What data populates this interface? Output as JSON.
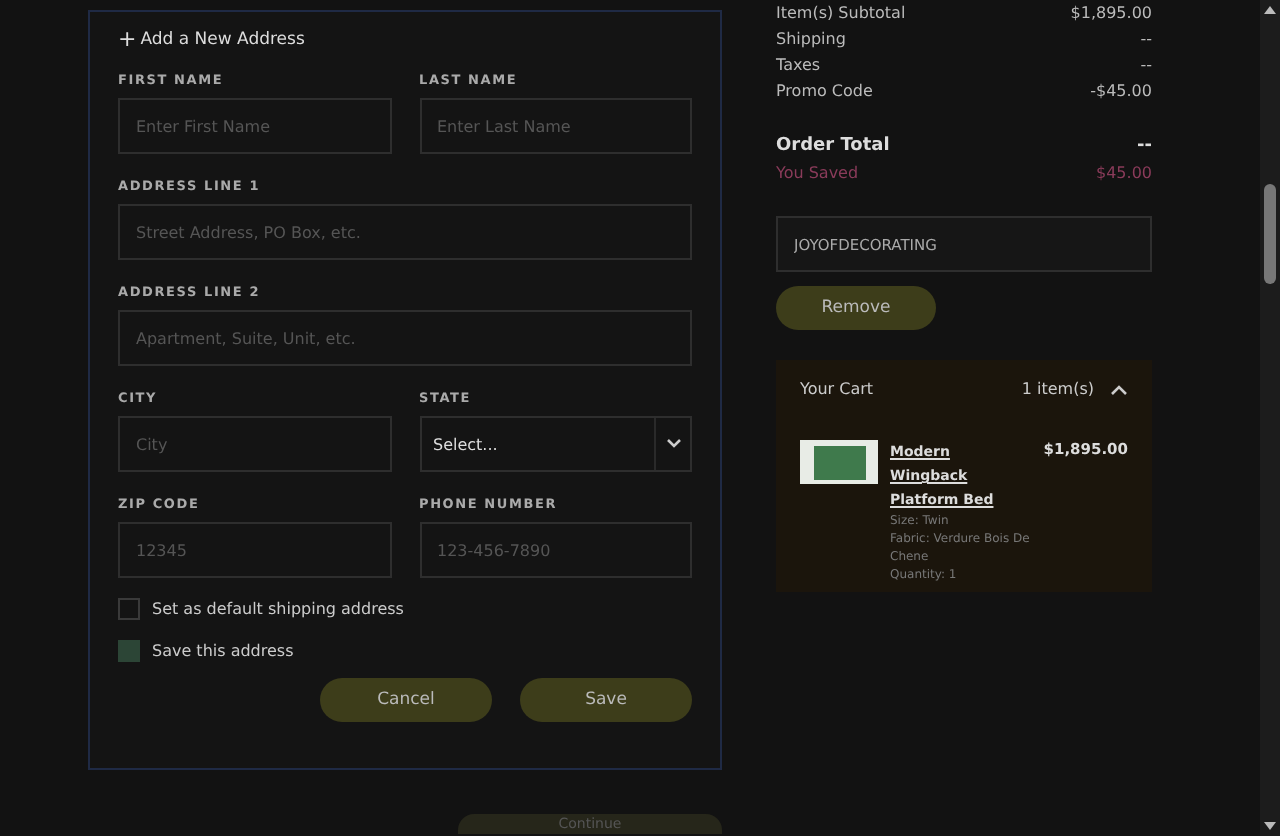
{
  "address_form": {
    "icon": "+",
    "title": "Add a New Address",
    "field_rows": [
      [
        {
          "label": "FIRST NAME",
          "placeholder": "Enter First Name",
          "kind": "text"
        },
        {
          "label": "LAST NAME",
          "placeholder": "Enter Last Name",
          "kind": "text"
        }
      ],
      [
        {
          "label": "ADDRESS LINE 1",
          "placeholder": "Street Address, PO Box, etc.",
          "kind": "text"
        }
      ],
      [
        {
          "label": "ADDRESS LINE 2",
          "placeholder": "Apartment, Suite, Unit, etc.",
          "kind": "text"
        }
      ],
      [
        {
          "label": "CITY",
          "placeholder": "City",
          "kind": "text"
        },
        {
          "label": "STATE",
          "value": "Select...",
          "kind": "select"
        }
      ],
      [
        {
          "label": "ZIP CODE",
          "placeholder": "12345",
          "kind": "text"
        },
        {
          "label": "PHONE NUMBER",
          "placeholder": "123-456-7890",
          "kind": "text"
        }
      ]
    ],
    "checkboxes": [
      {
        "label": "Set as default shipping address",
        "checked": false
      },
      {
        "label": "Save this address",
        "checked": true
      }
    ],
    "buttons": [
      "Cancel",
      "Save"
    ]
  },
  "continue_button": "Continue",
  "summary": {
    "rows": [
      {
        "label": "Item(s) Subtotal",
        "value": "$1,895.00"
      },
      {
        "label": "Shipping",
        "value": "--"
      },
      {
        "label": "Taxes",
        "value": "--"
      },
      {
        "label": "Promo Code",
        "value": "-$45.00"
      }
    ],
    "total": {
      "label": "Order Total",
      "value": "--"
    },
    "saved": {
      "label": "You Saved",
      "value": "$45.00"
    },
    "promo_code": {
      "value": "JOYOFDECORATING"
    },
    "remove_button": "Remove"
  },
  "cart": {
    "title": "Your Cart",
    "count": "1 item(s)",
    "expanded": true,
    "items": [
      {
        "name": "Modern Wingback Platform Bed",
        "price": "$1,895.00",
        "details": [
          "Size: Twin",
          "Fabric: Verdure Bois De Chene",
          "Quantity: 1"
        ]
      }
    ]
  }
}
